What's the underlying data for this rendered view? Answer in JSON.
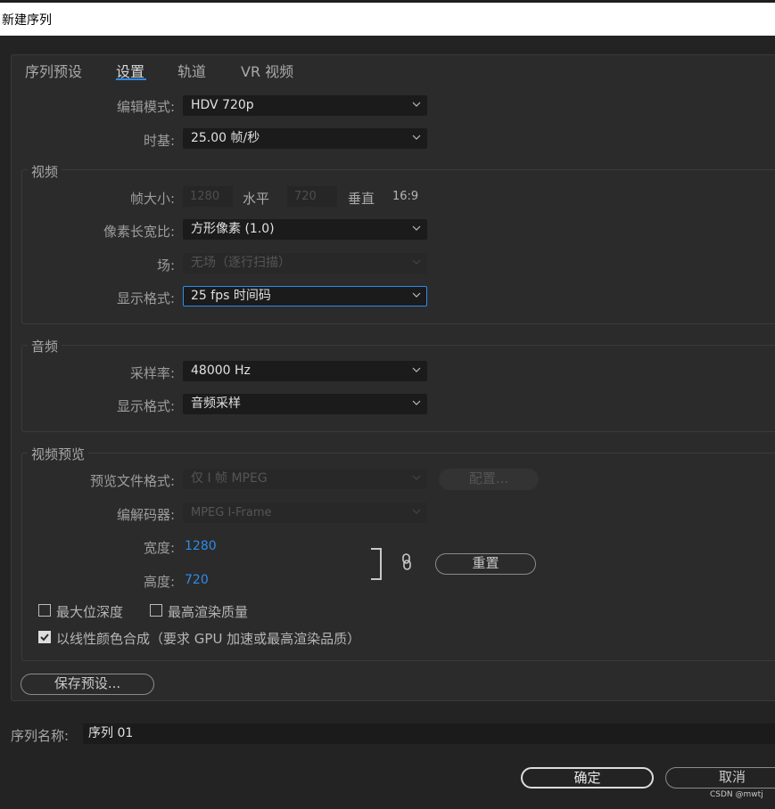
{
  "window": {
    "title": "新建序列"
  },
  "tabs": [
    {
      "label": "序列预设"
    },
    {
      "label": "设置"
    },
    {
      "label": "轨道"
    },
    {
      "label": "VR 视频"
    }
  ],
  "settings": {
    "edit_mode": {
      "label": "编辑模式:",
      "value": "HDV 720p"
    },
    "timebase": {
      "label": "时基:",
      "value": "25.00  帧/秒"
    }
  },
  "video": {
    "title": "视频",
    "frame_size": {
      "label": "帧大小:",
      "width": "1280",
      "width_label": "水平",
      "height": "720",
      "height_label": "垂直",
      "aspect": "16:9"
    },
    "pixel_aspect": {
      "label": "像素长宽比:",
      "value": "方形像素 (1.0)"
    },
    "fields": {
      "label": "场:",
      "value": "无场（逐行扫描）"
    },
    "display_format": {
      "label": "显示格式:",
      "value": "25 fps 时间码"
    }
  },
  "audio": {
    "title": "音频",
    "sample_rate": {
      "label": "采样率:",
      "value": "48000 Hz"
    },
    "display_format": {
      "label": "显示格式:",
      "value": "音频采样"
    }
  },
  "video_preview": {
    "title": "视频预览",
    "file_format": {
      "label": "预览文件格式:",
      "value": "仅 I 帧 MPEG"
    },
    "configure_button": "配置...",
    "codec": {
      "label": "编解码器:",
      "value": "MPEG I-Frame"
    },
    "width": {
      "label": "宽度:",
      "value": "1280"
    },
    "height": {
      "label": "高度:",
      "value": "720"
    },
    "reset_button": "重置",
    "max_bit_depth": {
      "label": "最大位深度",
      "checked": false
    },
    "max_render_quality": {
      "label": "最高渲染质量",
      "checked": false
    },
    "linear_color": {
      "label": "以线性颜色合成（要求 GPU 加速或最高渲染品质）",
      "checked": true
    }
  },
  "save_preset_button": "保存预设...",
  "sequence_name": {
    "label": "序列名称:",
    "value": "序列 01"
  },
  "ok_button": "确定",
  "cancel_button": "取消",
  "watermark": "CSDN @mwtj",
  "colors": {
    "accent": "#2d8ceb",
    "background": "#232323",
    "panel": "#2b2b2b",
    "field": "#1b1b1b"
  }
}
